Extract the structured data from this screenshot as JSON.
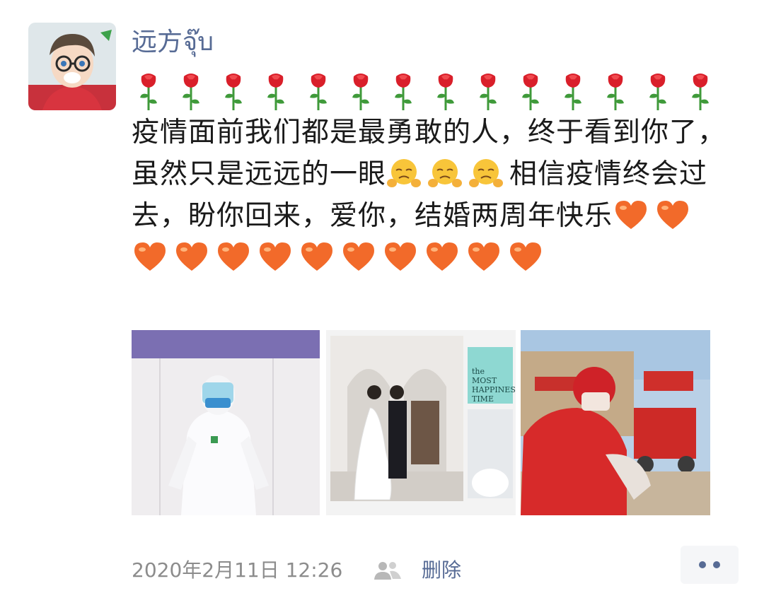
{
  "post": {
    "avatar_icon": "avatar-cartoon-icon",
    "nickname": "远方จุ๊บ",
    "rose_icon": "rose-emoji-icon",
    "rose_count": 14,
    "text_part1": "疫情面前我们都是最勇敢的人，终于看到你了，虽然只是远远的一眼",
    "text_part2": "相信疫情终会过去，盼你回来，爱你，结婚两周年快乐",
    "crying_emoji_icon": "crying-face-emoji-icon",
    "crying_emoji_count": 3,
    "heart_icon": "orange-heart-emoji-icon",
    "heart_count": 12,
    "photos": [
      {
        "description_icon": "protective-suit-photo"
      },
      {
        "description_icon": "wedding-photo",
        "overlay_text": "the MOST HAPPINESS TIME"
      },
      {
        "description_icon": "delivery-rider-photo"
      }
    ],
    "timestamp": "2020年2月11日 12:26",
    "visibility_icon": "friends-icon",
    "delete_label": "删除",
    "more_icon": "more-dots-icon"
  },
  "colors": {
    "link": "#576b95",
    "text": "#1a1a1a",
    "meta": "#8c8c8c"
  }
}
